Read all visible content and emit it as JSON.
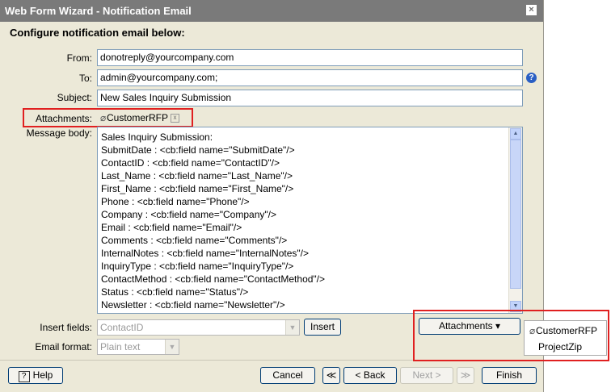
{
  "window": {
    "title": "Web Form Wizard - Notification Email",
    "close_label": "×"
  },
  "heading": "Configure notification email below:",
  "labels": {
    "from": "From:",
    "to": "To:",
    "subject": "Subject:",
    "attachments": "Attachments:",
    "message_body": "Message body:",
    "insert_fields": "Insert fields:",
    "email_format": "Email format:"
  },
  "fields": {
    "from": "donotreply@yourcompany.com",
    "to": "admin@yourcompany.com;",
    "subject": "New Sales Inquiry Submission"
  },
  "help_icon": "?",
  "attachment": {
    "name": "CustomerRFP",
    "remove": "x",
    "icon": "paperclip-icon"
  },
  "message_lines": [
    "Sales Inquiry Submission:",
    "SubmitDate : <cb:field name=\"SubmitDate\"/>",
    "ContactID : <cb:field name=\"ContactID\"/>",
    "Last_Name : <cb:field name=\"Last_Name\"/>",
    "First_Name : <cb:field name=\"First_Name\"/>",
    "Phone : <cb:field name=\"Phone\"/>",
    "Company : <cb:field name=\"Company\"/>",
    "Email : <cb:field name=\"Email\"/>",
    "Comments : <cb:field name=\"Comments\"/>",
    "InternalNotes : <cb:field name=\"InternalNotes\"/>",
    "InquiryType : <cb:field name=\"InquiryType\"/>",
    "ContactMethod : <cb:field name=\"ContactMethod\"/>",
    "Status : <cb:field name=\"Status\"/>",
    "Newsletter : <cb:field name=\"Newsletter\"/>"
  ],
  "insert_field_value": "ContactID",
  "insert_button": "Insert",
  "email_format_value": "Plain text",
  "attachments_button": "Attachments ▾",
  "attachments_menu": [
    "CustomerRFP",
    "ProjectZip"
  ],
  "footer": {
    "help": "Help",
    "help_icon": "?",
    "cancel": "Cancel",
    "first": "≪",
    "back": "< Back",
    "next": "Next >",
    "last": "≫",
    "finish": "Finish"
  }
}
